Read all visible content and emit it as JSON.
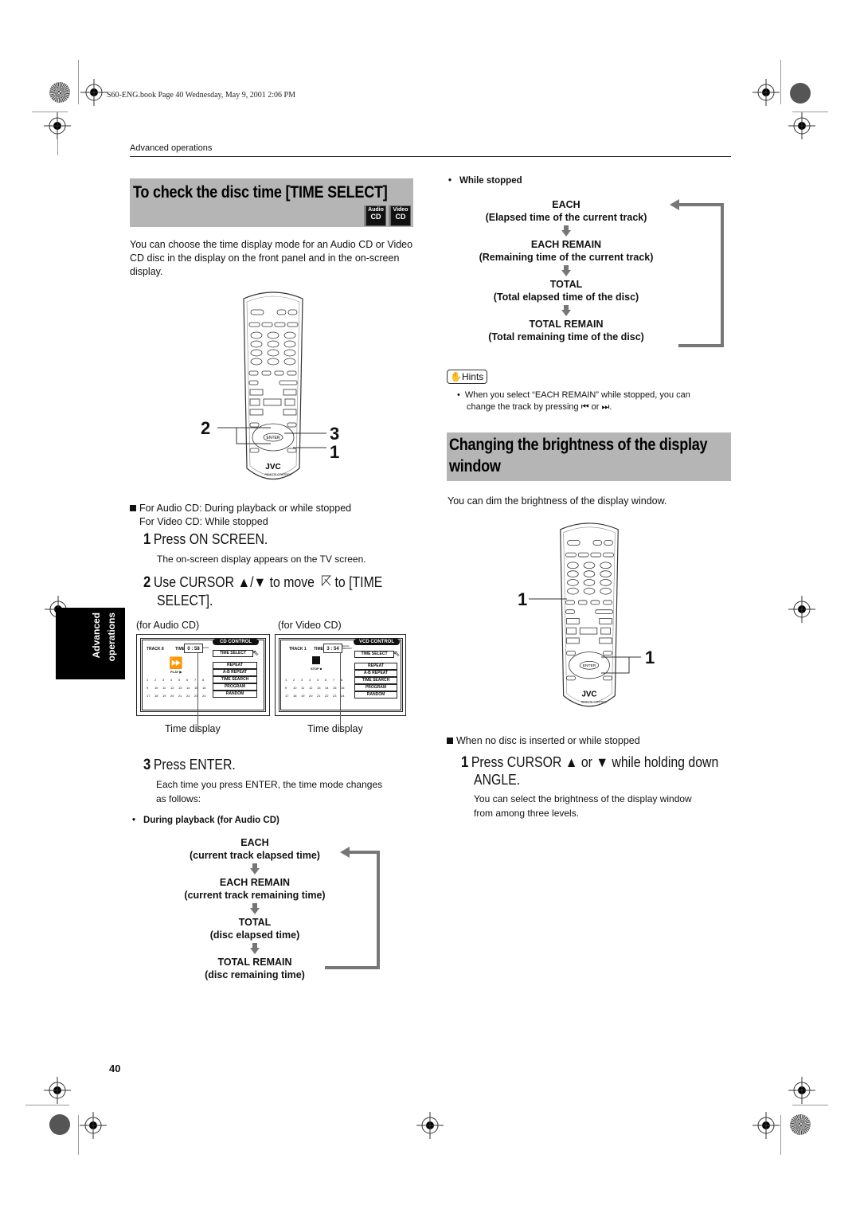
{
  "header": {
    "book_line": "S60-ENG.book  Page 40  Wednesday, May 9, 2001  2:06 PM",
    "running_head": "Advanced operations"
  },
  "side_tab": {
    "line1": "Advanced",
    "line2": "operations"
  },
  "section1": {
    "title": "To check the disc time [TIME SELECT]",
    "badges": [
      {
        "top": "Audio",
        "bottom": "CD"
      },
      {
        "top": "Video",
        "bottom": "CD"
      }
    ],
    "intro": "You can choose the time display mode for an Audio CD or Video CD disc in the display on the front panel and in the on-screen display.",
    "callouts": {
      "left": "2",
      "right_top": "3",
      "right_bottom": "1"
    },
    "condition_line1": "For Audio CD: During playback or while stopped",
    "condition_line2": "For Video CD:  While stopped",
    "step1": {
      "num": "1",
      "text": "Press ON SCREEN.",
      "detail": "The on-screen display appears on the TV screen."
    },
    "step2": {
      "num": "2",
      "text_a": "Use CURSOR ▲/▼ to move",
      "text_b": "to [TIME",
      "text_c": "SELECT]."
    },
    "osd_audio": {
      "caption": "(for Audio CD)",
      "control_label": "CD CONTROL",
      "track_label": "TRACK 8",
      "time_label": "TIME",
      "time_value": "0 : 58",
      "mode_tag": "EACH",
      "status": "PLAY ▶",
      "menu": [
        "TIME SELECT",
        "REPEAT",
        "A-B REPEAT",
        "TIME SEARCH",
        "PROGRAM",
        "RANDOM"
      ],
      "tracks": [
        "1",
        "2",
        "3",
        "4",
        "5",
        "6",
        "7",
        "8",
        "9",
        "10",
        "11",
        "12",
        "13",
        "14",
        "15",
        "16",
        "17",
        "18",
        "19",
        "20",
        "21",
        "22",
        "23",
        "24"
      ],
      "pointer_label": "Time display"
    },
    "osd_video": {
      "caption": "(for Video CD)",
      "control_label": "VCD CONTROL",
      "track_label": "TRACK 1",
      "time_label": "TIME",
      "time_value": "3 : 54",
      "mode_tag": "EACH REMAIN",
      "status": "STOP ■",
      "menu": [
        "TIME SELECT",
        "REPEAT",
        "A-B REPEAT",
        "TIME SEARCH",
        "PROGRAM",
        "RANDOM"
      ],
      "tracks": [
        "1",
        "2",
        "3",
        "4",
        "5",
        "6",
        "7",
        "8",
        "9",
        "10",
        "11",
        "12",
        "13",
        "14",
        "15",
        "16",
        "17",
        "18",
        "19",
        "20",
        "21",
        "22",
        "23",
        "24"
      ],
      "pointer_label": "Time display"
    },
    "step3": {
      "num": "3",
      "text": "Press ENTER.",
      "detail": "Each time you press ENTER, the time mode changes as follows:"
    },
    "playback_heading": "During playback (for Audio CD)",
    "playback_flow": [
      {
        "name": "EACH",
        "desc": "(current track elapsed time)"
      },
      {
        "name": "EACH REMAIN",
        "desc": "(current track remaining time)"
      },
      {
        "name": "TOTAL",
        "desc": "(disc elapsed time)"
      },
      {
        "name": "TOTAL REMAIN",
        "desc": "(disc remaining time)"
      }
    ],
    "stopped_heading": "While stopped",
    "stopped_flow": [
      {
        "name": "EACH",
        "desc": "(Elapsed time of the current track)"
      },
      {
        "name": "EACH REMAIN",
        "desc": "(Remaining time of the current track)"
      },
      {
        "name": "TOTAL",
        "desc": "(Total elapsed time of the disc)"
      },
      {
        "name": "TOTAL REMAIN",
        "desc": "(Total remaining time of the disc)"
      }
    ],
    "hints": {
      "label": "Hints",
      "text_line1": "When you select “EACH REMAIN” while stopped, you can",
      "text_line2": "change the track by pressing ⏮ or ⏭."
    }
  },
  "section2": {
    "title_line1": "Changing the brightness of the display",
    "title_line2": "window",
    "intro": "You can dim the brightness of the display window.",
    "callouts": {
      "left": "1",
      "right": "1"
    },
    "condition": "When no disc is inserted or while stopped",
    "step1": {
      "num": "1",
      "text_line1": "Press CURSOR ▲ or ▼ while holding down",
      "text_line2": "ANGLE.",
      "detail": "You can select the brightness of the display window from among three levels."
    }
  },
  "remote": {
    "brand": "JVC",
    "subtitle": "REMOTE CONTROL",
    "enter": "ENTER"
  },
  "footer": {
    "page_number": "40"
  }
}
